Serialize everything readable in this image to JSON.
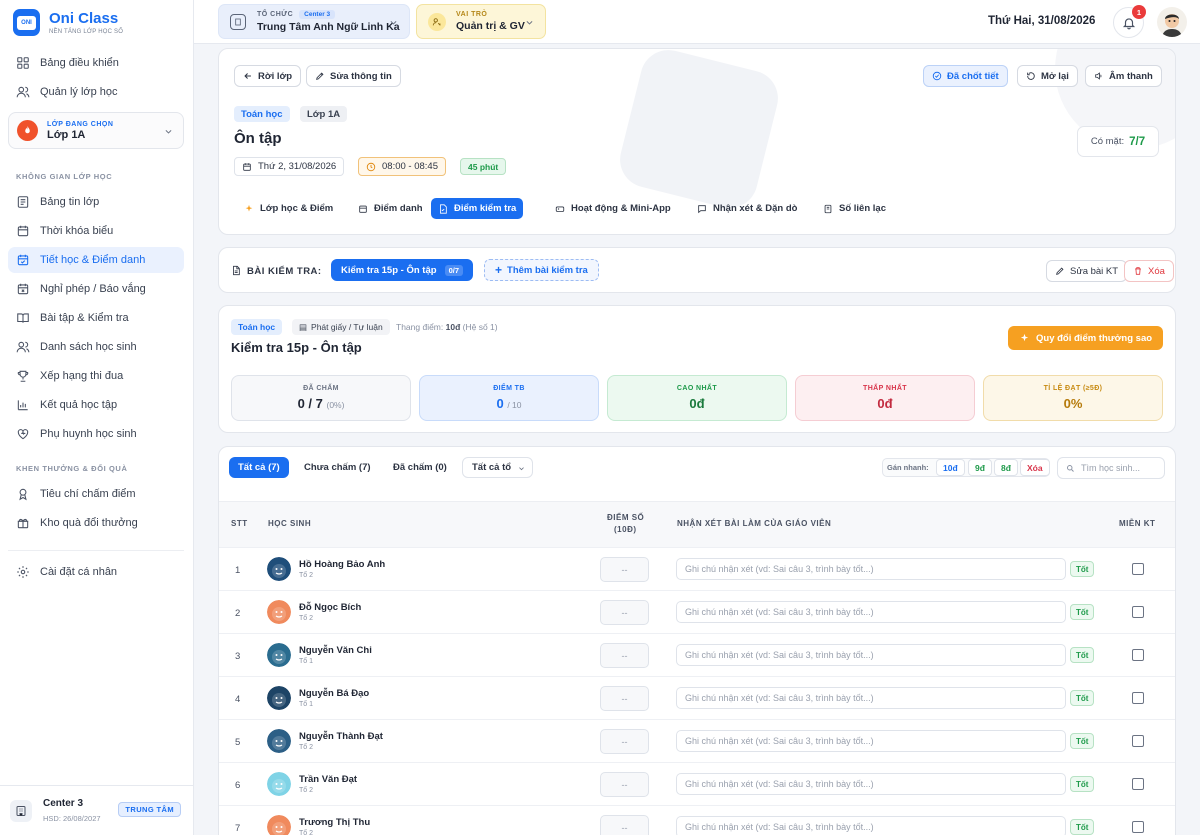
{
  "brand": {
    "name": "Oni Class",
    "subtitle": "NỀN TẢNG LỚP HỌC SỐ",
    "logo_text": "ONI"
  },
  "sidebar": {
    "items_top": [
      {
        "label": "Bảng điều khiển",
        "icon": "dashboard-icon"
      },
      {
        "label": "Quản lý lớp học",
        "icon": "users-icon"
      }
    ],
    "class_selector": {
      "label": "LỚP ĐANG CHỌN",
      "value": "Lớp 1A"
    },
    "section_class": "KHÔNG GIAN LỚP HỌC",
    "items_class": [
      {
        "label": "Bảng tin lớp",
        "icon": "newsfeed-icon"
      },
      {
        "label": "Thời khóa biểu",
        "icon": "calendar-icon"
      },
      {
        "label": "Tiết học & Điểm danh",
        "icon": "calendar-check-icon",
        "active": true
      },
      {
        "label": "Nghỉ phép / Báo vắng",
        "icon": "calendar-x-icon"
      },
      {
        "label": "Bài tập & Kiểm tra",
        "icon": "book-icon"
      },
      {
        "label": "Danh sách học sinh",
        "icon": "users-icon"
      },
      {
        "label": "Xếp hạng thi đua",
        "icon": "trophy-icon"
      },
      {
        "label": "Kết quả học tập",
        "icon": "bar-chart-icon"
      },
      {
        "label": "Phụ huynh học sinh",
        "icon": "heart-icon"
      }
    ],
    "section_reward": "KHEN THƯỞNG & ĐỔI QUÀ",
    "items_reward": [
      {
        "label": "Tiêu chí chấm điểm",
        "icon": "award-icon"
      },
      {
        "label": "Kho quà đổi thưởng",
        "icon": "gift-icon"
      }
    ],
    "items_bottom": [
      {
        "label": "Cài đặt cá nhân",
        "icon": "gear-icon"
      }
    ],
    "footer": {
      "name": "Center 3",
      "expiry": "HSD: 26/08/2027",
      "badge": "TRUNG TÂM"
    }
  },
  "topbar": {
    "org_label": "TỔ CHỨC",
    "org_badge": "Center 3",
    "org_name": "Trung Tâm Anh Ngữ Linh Ka",
    "role_label": "VAI TRÒ",
    "role_value": "Quản trị & GV",
    "date": "Thứ Hai, 31/08/2026",
    "notif_count": "1"
  },
  "lesson": {
    "back": "Rời lớp",
    "edit": "Sửa thông tin",
    "finalized": "Đã chốt tiết",
    "reopen": "Mở lại",
    "sound": "Âm thanh",
    "subject": "Toán học",
    "class": "Lớp 1A",
    "title": "Ôn tập",
    "date": "Thứ 2, 31/08/2026",
    "time": "08:00 - 08:45",
    "duration": "45 phút",
    "present_label": "Có mặt:",
    "present_value": "7/7",
    "tabs": [
      "Lớp học & Điểm",
      "Điểm danh",
      "Điểm kiểm tra",
      "Hoạt động & Mini-App",
      "Nhận xét & Dặn dò",
      "Số liên lạc"
    ],
    "active_tab": 2
  },
  "tests": {
    "label": "BÀI KIỂM TRA:",
    "current": "Kiểm tra 15p - Ôn tập",
    "current_count": "0/7",
    "add": "Thêm bài kiểm tra",
    "edit": "Sửa bài KT",
    "delete": "Xóa"
  },
  "test_detail": {
    "subject": "Toán học",
    "type": "Phát giấy / Tự luận",
    "scale_label": "Thang điểm:",
    "scale_value": "10đ",
    "coef": "(Hệ số 1)",
    "title": "Kiểm tra 15p - Ôn tập",
    "convert": "Quy đổi điểm thưởng sao",
    "stats": [
      {
        "label": "ĐÃ CHẤM",
        "value": "0 / 7",
        "sub": "(0%)"
      },
      {
        "label": "ĐIỂM TB",
        "value": "0",
        "sub": "/ 10"
      },
      {
        "label": "CAO NHẤT",
        "value": "0đ",
        "sub": ""
      },
      {
        "label": "THẤP NHẤT",
        "value": "0đ",
        "sub": ""
      },
      {
        "label": "TỈ LỆ ĐẠT (≥5Đ)",
        "value": "0%",
        "sub": ""
      }
    ]
  },
  "filters": {
    "all": "Tất cả (7)",
    "ungraded": "Chưa chấm (7)",
    "graded": "Đã chấm (0)",
    "group": "Tất cả tổ",
    "quick_label": "Gán nhanh:",
    "quick": [
      "10đ",
      "9đ",
      "8đ",
      "Xóa"
    ],
    "search_placeholder": "Tìm học sinh..."
  },
  "table": {
    "headers": {
      "stt": "STT",
      "student": "HỌC SINH",
      "score": "ĐIỂM SỐ",
      "score_sub": "(10Đ)",
      "comment": "NHẬN XÉT BÀI LÀM CỦA GIÁO VIÊN",
      "exempt": "MIỄN KT"
    },
    "score_placeholder": "--",
    "comment_placeholder": "Ghi chú nhận xét (vd: Sai câu 3, trình bày tốt...)",
    "good": "Tốt",
    "rows": [
      {
        "stt": "1",
        "name": "Hồ Hoàng Bảo Anh",
        "group": "Tổ 2",
        "avatar_color": "#1f4e7a"
      },
      {
        "stt": "2",
        "name": "Đỗ Ngọc Bích",
        "group": "Tổ 2",
        "avatar_color": "#f08a5d"
      },
      {
        "stt": "3",
        "name": "Nguyễn Văn Chi",
        "group": "Tổ 1",
        "avatar_color": "#2a6c8f"
      },
      {
        "stt": "4",
        "name": "Nguyễn Bá Đạo",
        "group": "Tổ 1",
        "avatar_color": "#1d4466"
      },
      {
        "stt": "5",
        "name": "Nguyễn Thành Đạt",
        "group": "Tổ 2",
        "avatar_color": "#2c5f86"
      },
      {
        "stt": "6",
        "name": "Trần Văn Đạt",
        "group": "Tổ 2",
        "avatar_color": "#7fd3e6"
      },
      {
        "stt": "7",
        "name": "Trương Thị Thu",
        "group": "Tổ 2",
        "avatar_color": "#f08a5d"
      }
    ]
  }
}
